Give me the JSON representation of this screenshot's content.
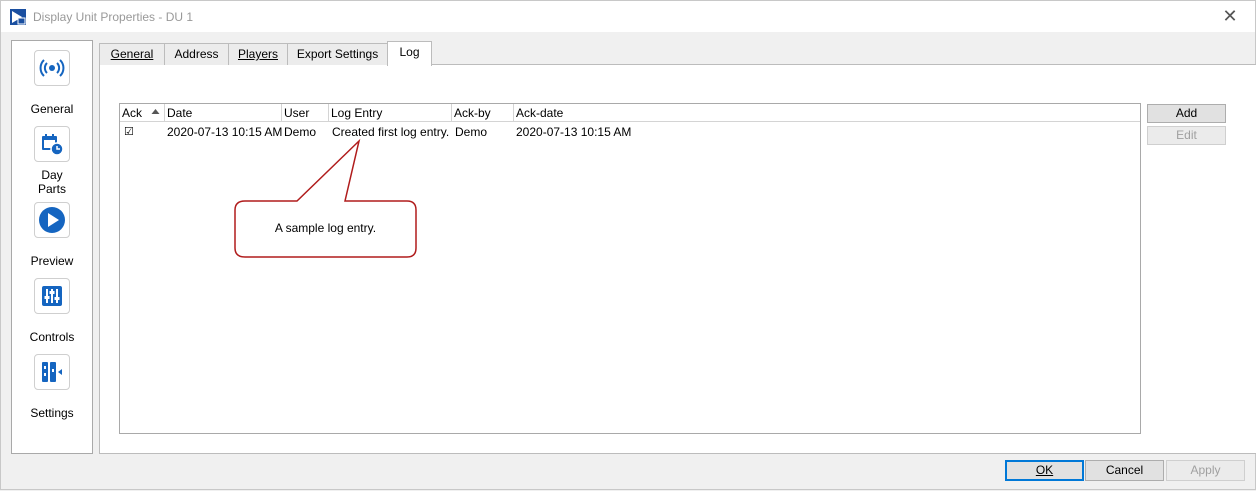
{
  "window": {
    "title": "Display Unit Properties - DU 1",
    "close_glyph": "✕"
  },
  "nav": {
    "items": [
      {
        "label": "General",
        "icon": "broadcast-icon"
      },
      {
        "label": "Day\nParts",
        "icon": "calendar-clock-icon"
      },
      {
        "label": "Preview",
        "icon": "play-icon"
      },
      {
        "label": "Controls",
        "icon": "sliders-icon"
      },
      {
        "label": "Settings",
        "icon": "settings-panel-icon"
      }
    ]
  },
  "tabs": [
    {
      "label": "General",
      "active": false
    },
    {
      "label": "Address",
      "active": false
    },
    {
      "label": "Players",
      "active": false
    },
    {
      "label": "Export Settings",
      "active": false
    },
    {
      "label": "Log",
      "active": true
    }
  ],
  "log_table": {
    "columns": [
      "Ack",
      "Date",
      "User",
      "Log Entry",
      "Ack-by",
      "Ack-date"
    ],
    "sorted_column": "Ack",
    "rows": [
      {
        "ack": "☑",
        "date": "2020-07-13 10:15 AM",
        "user": "Demo",
        "entry": "Created first log entry.",
        "ack_by": "Demo",
        "ack_date": "2020-07-13 10:15 AM"
      }
    ]
  },
  "side_buttons": {
    "add": "Add",
    "edit": "Edit",
    "edit_enabled": false
  },
  "callout": {
    "text": "A sample log entry.",
    "border_color": "#b01c1c"
  },
  "footer": {
    "ok": "OK",
    "cancel": "Cancel",
    "apply": "Apply",
    "apply_enabled": false
  },
  "colors": {
    "accent": "#1565c0",
    "callout_border": "#b01c1c"
  }
}
